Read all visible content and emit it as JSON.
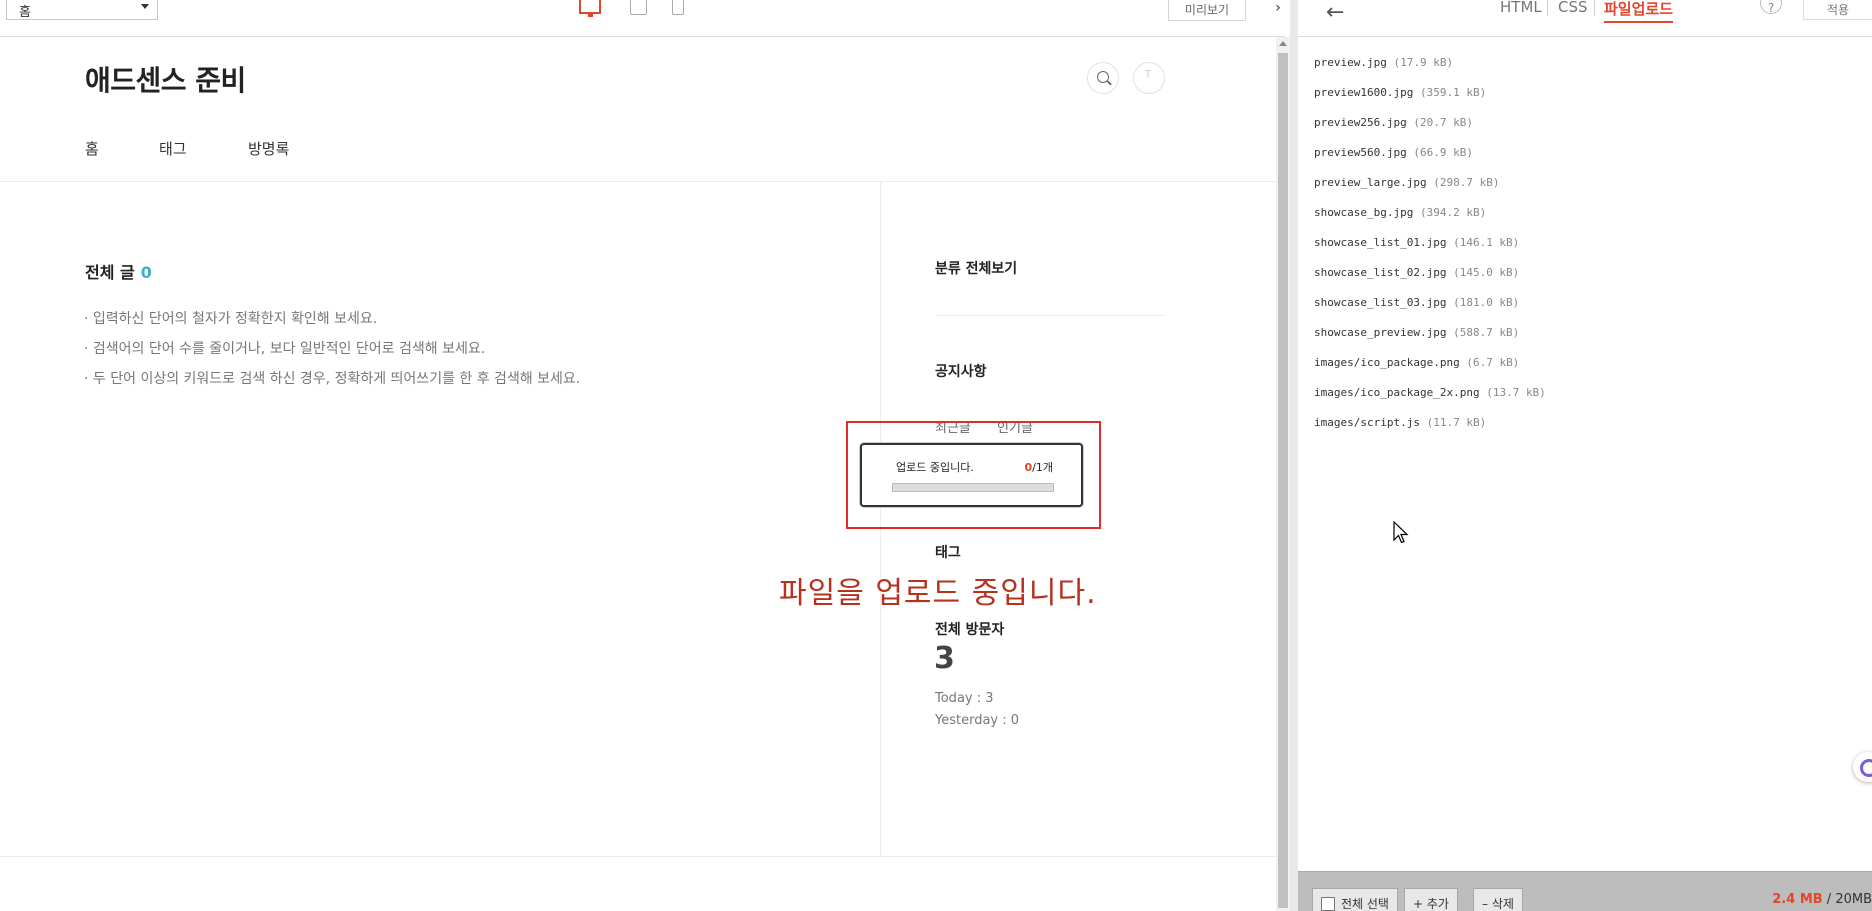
{
  "toolbar": {
    "page_select": "홈",
    "devices": [
      "desktop-icon",
      "tablet-icon",
      "mobile-icon"
    ],
    "preview_label": "미리보기",
    "collapse_glyph": "›"
  },
  "blog": {
    "title": "애드센스 준비",
    "nav": [
      "홈",
      "태그",
      "방명록"
    ],
    "all_posts_label": "전체 글",
    "all_posts_count": "0",
    "tips": [
      "· 입력하신 단어의 철자가 정확한지 확인해 보세요.",
      "· 검색어의 단어 수를 줄이거나, 보다 일반적인 단어로 검색해 보세요.",
      "· 두 단어 이상의 키워드로 검색 하신 경우, 정확하게 띄어쓰기를 한 후 검색해 보세요."
    ],
    "sidebar": {
      "category": "분류 전체보기",
      "notice": "공지사항",
      "tabs": [
        "최근글",
        "인기글"
      ],
      "tag": "태그",
      "visitors_label": "전체 방문자",
      "visitors_total": "3",
      "today": "Today : 3",
      "yesterday": "Yesterday : 0"
    }
  },
  "upload": {
    "message": "업로드 중입니다.",
    "done": "0",
    "total": "/1개",
    "progress": 0,
    "caption": "파일을 업로드 중입니다."
  },
  "panel": {
    "back_glyph": "←",
    "tabs": [
      "HTML",
      "CSS",
      "파일업로드"
    ],
    "active_tab": "파일업로드",
    "help_glyph": "?",
    "apply_label": "적용",
    "files": [
      {
        "name": "preview.jpg",
        "size": "(17.9 kB)"
      },
      {
        "name": "preview1600.jpg",
        "size": "(359.1 kB)"
      },
      {
        "name": "preview256.jpg",
        "size": "(20.7 kB)"
      },
      {
        "name": "preview560.jpg",
        "size": "(66.9 kB)"
      },
      {
        "name": "preview_large.jpg",
        "size": "(298.7 kB)"
      },
      {
        "name": "showcase_bg.jpg",
        "size": "(394.2 kB)"
      },
      {
        "name": "showcase_list_01.jpg",
        "size": "(146.1 kB)"
      },
      {
        "name": "showcase_list_02.jpg",
        "size": "(145.0 kB)"
      },
      {
        "name": "showcase_list_03.jpg",
        "size": "(181.0 kB)"
      },
      {
        "name": "showcase_preview.jpg",
        "size": "(588.7 kB)"
      },
      {
        "name": "images/ico_package.png",
        "size": "(6.7 kB)"
      },
      {
        "name": "images/ico_package_2x.png",
        "size": "(13.7 kB)"
      },
      {
        "name": "images/script.js",
        "size": "(11.7 kB)"
      }
    ],
    "footer": {
      "select_all": "전체 선택",
      "add": "+ 추가",
      "delete": "– 삭제",
      "used": "2.4 MB",
      "limit": " / 20MB"
    }
  },
  "colors": {
    "accent": "#e1472b",
    "count": "#3bb0c9",
    "highlight": "#e12b2b",
    "caption": "#b5321c"
  }
}
